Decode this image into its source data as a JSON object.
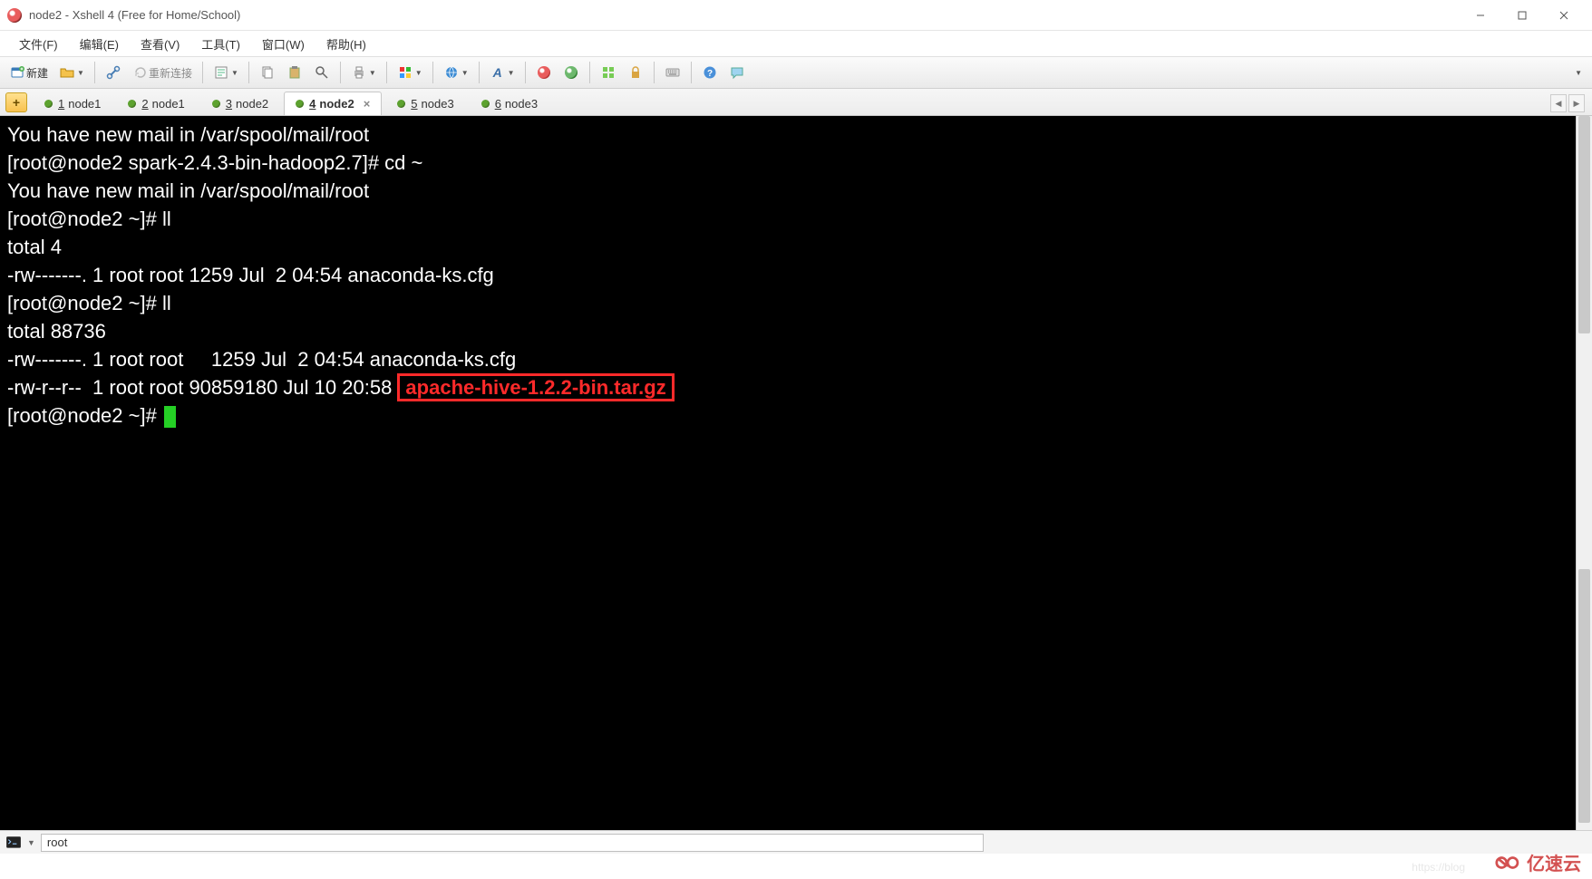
{
  "window": {
    "title": "node2 - Xshell 4 (Free for Home/School)"
  },
  "menu": {
    "file": "文件(F)",
    "edit": "编辑(E)",
    "view": "查看(V)",
    "tools": "工具(T)",
    "window": "窗口(W)",
    "help": "帮助(H)"
  },
  "toolbar": {
    "new_label": "新建",
    "reconnect_label": "重新连接"
  },
  "tabs": [
    {
      "num": "1",
      "label": "node1",
      "active": false
    },
    {
      "num": "2",
      "label": "node1",
      "active": false
    },
    {
      "num": "3",
      "label": "node2",
      "active": false
    },
    {
      "num": "4",
      "label": "node2",
      "active": true
    },
    {
      "num": "5",
      "label": "node3",
      "active": false
    },
    {
      "num": "6",
      "label": "node3",
      "active": false
    }
  ],
  "terminal": {
    "line1": "You have new mail in /var/spool/mail/root",
    "line2": "[root@node2 spark-2.4.3-bin-hadoop2.7]# cd ~",
    "line3": "You have new mail in /var/spool/mail/root",
    "line4": "[root@node2 ~]# ll",
    "line5": "total 4",
    "line6": "-rw-------. 1 root root 1259 Jul  2 04:54 anaconda-ks.cfg",
    "line7": "[root@node2 ~]# ll",
    "line8": "total 88736",
    "line9": "-rw-------. 1 root root     1259 Jul  2 04:54 anaconda-ks.cfg",
    "line10_pre": "-rw-r--r--  1 root root 90859180 Jul 10 20:58 ",
    "line10_hl": "apache-hive-1.2.2-bin.tar.gz",
    "line11": "[root@node2 ~]# "
  },
  "bottom": {
    "input_value": "root"
  },
  "watermark": {
    "text": "亿速云"
  }
}
